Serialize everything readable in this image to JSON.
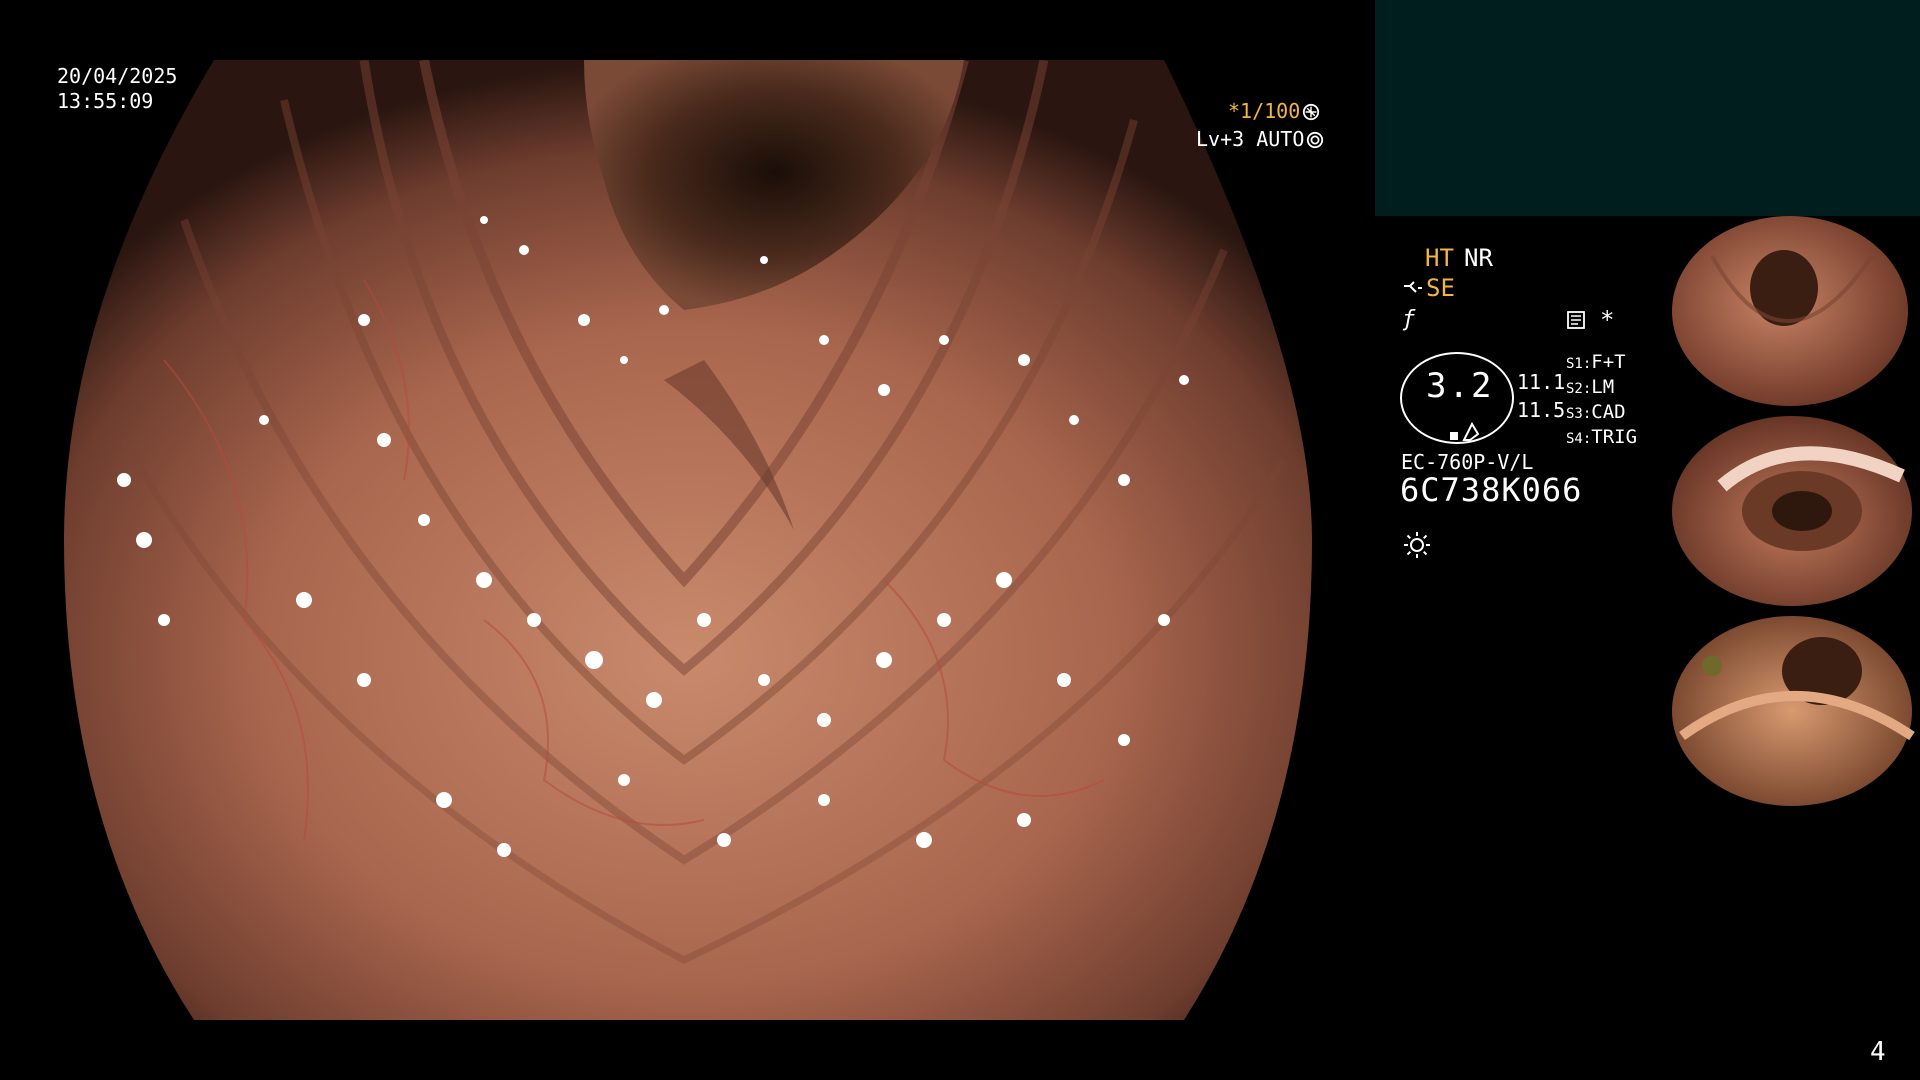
{
  "overlay": {
    "date": "20/04/2025",
    "time": "13:55:09",
    "shutter": "*1/100",
    "level": "Lv+3 AUTO"
  },
  "status": {
    "ht": "HT",
    "nr": "NR",
    "se": "SE",
    "star": "*"
  },
  "zoom": {
    "value": "3.2",
    "a": "11.1",
    "b": "11.5"
  },
  "settings": [
    {
      "key": "S1:",
      "value": "F+T"
    },
    {
      "key": "S2:",
      "value": "LM"
    },
    {
      "key": "S3:",
      "value": "CAD"
    },
    {
      "key": "S4:",
      "value": "TRIG"
    }
  ],
  "scope": {
    "model": "EC-760P-V/L",
    "serial": "6C738K066"
  },
  "page_number": "4",
  "colors": {
    "accent_orange": "#f2b640",
    "panel_teal": "#011e1e",
    "tissue": "#b0705a"
  },
  "icons": [
    "shutter-icon",
    "auto-iris-icon",
    "se-icon",
    "f-icon",
    "memo-icon",
    "sun-icon"
  ]
}
